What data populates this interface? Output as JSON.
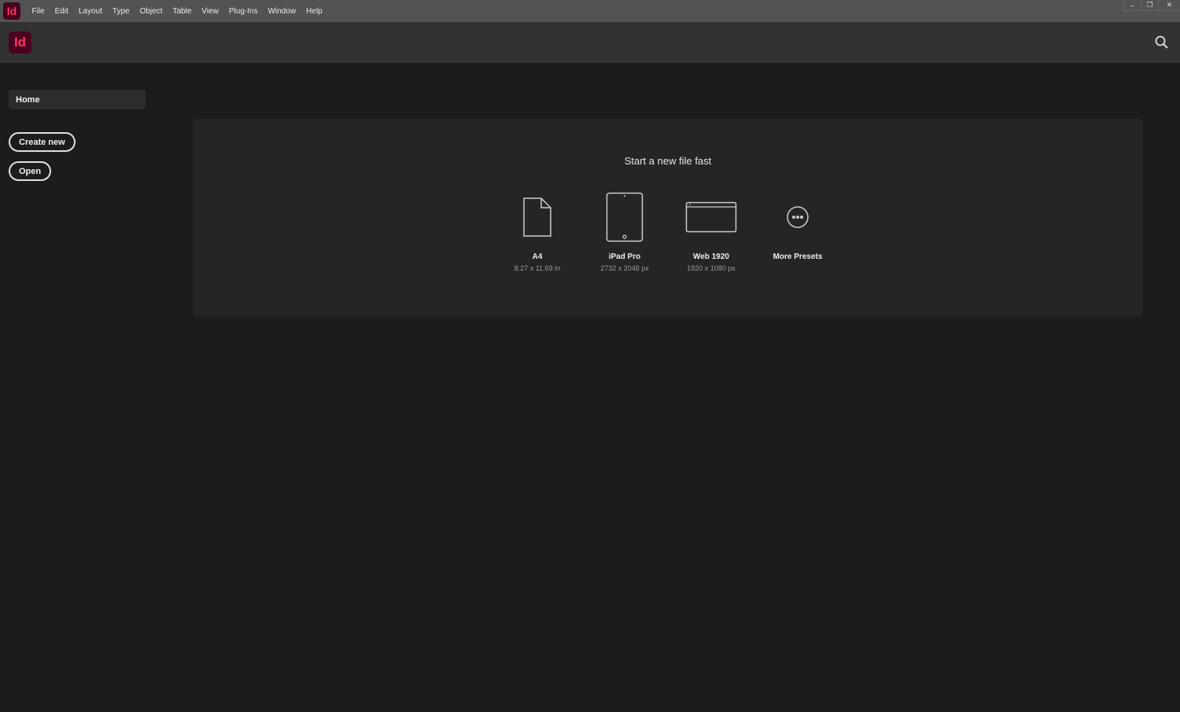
{
  "app": {
    "logo_text": "Id"
  },
  "menu": [
    "File",
    "Edit",
    "Layout",
    "Type",
    "Object",
    "Table",
    "View",
    "Plug-Ins",
    "Window",
    "Help"
  ],
  "window_controls": {
    "minimize": "–",
    "restore": "❐",
    "close": "✕"
  },
  "sidebar": {
    "home": "Home",
    "create_new": "Create new",
    "open": "Open"
  },
  "main": {
    "title": "Start a new file fast",
    "presets": [
      {
        "name": "A4",
        "dims": "8.27 x 11.69 in",
        "icon": "document-icon"
      },
      {
        "name": "iPad Pro",
        "dims": "2732 x 2048 px",
        "icon": "tablet-icon"
      },
      {
        "name": "Web 1920",
        "dims": "1920 x 1080 px",
        "icon": "browser-icon"
      },
      {
        "name": "More Presets",
        "dims": "",
        "icon": "more-icon"
      }
    ]
  }
}
